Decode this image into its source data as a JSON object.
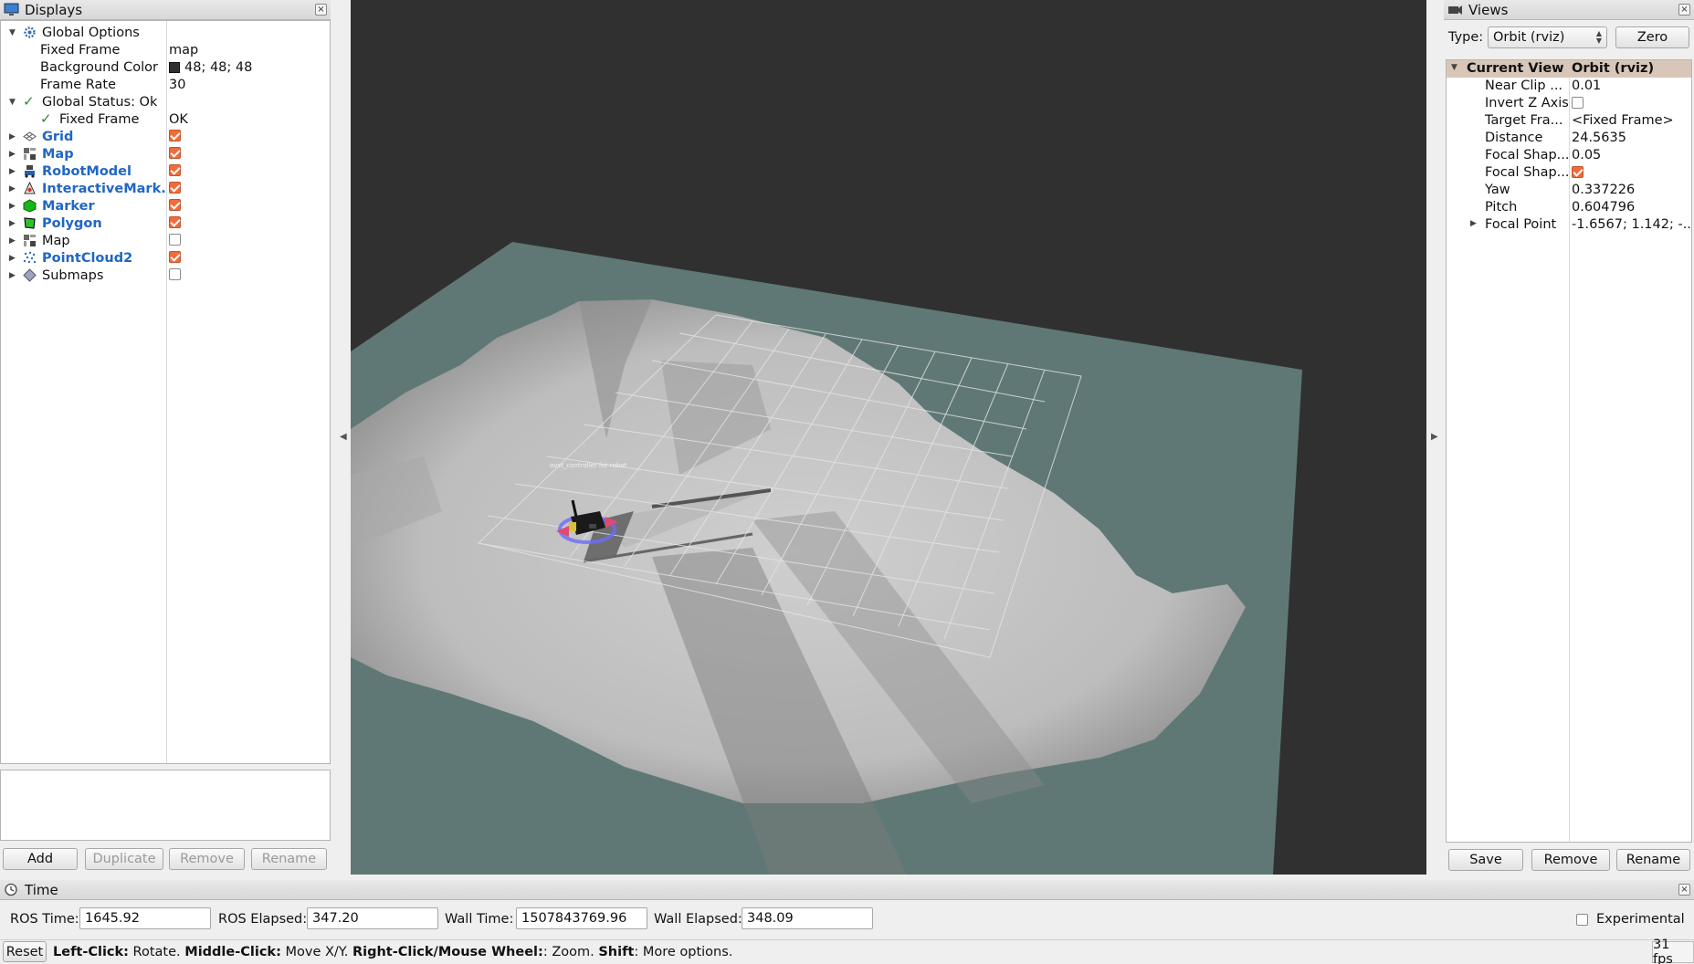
{
  "displays": {
    "title": "Displays",
    "global_options": {
      "label": "Global Options",
      "fixed_frame": {
        "label": "Fixed Frame",
        "value": "map"
      },
      "background_color": {
        "label": "Background Color",
        "value": "48; 48; 48",
        "swatch": "#303030"
      },
      "frame_rate": {
        "label": "Frame Rate",
        "value": "30"
      }
    },
    "global_status": {
      "label": "Global Status: Ok",
      "fixed_frame": {
        "label": "Fixed Frame",
        "value": "OK"
      }
    },
    "items": [
      {
        "label": "Grid",
        "enabled": true,
        "bold": true
      },
      {
        "label": "Map",
        "enabled": true,
        "bold": true
      },
      {
        "label": "RobotModel",
        "enabled": true,
        "bold": true
      },
      {
        "label": "InteractiveMark...",
        "enabled": true,
        "bold": true
      },
      {
        "label": "Marker",
        "enabled": true,
        "bold": true
      },
      {
        "label": "Polygon",
        "enabled": true,
        "bold": true
      },
      {
        "label": "Map",
        "enabled": false,
        "bold": false
      },
      {
        "label": "PointCloud2",
        "enabled": true,
        "bold": true
      },
      {
        "label": "Submaps",
        "enabled": false,
        "bold": false
      }
    ],
    "buttons": {
      "add": "Add",
      "duplicate": "Duplicate",
      "remove": "Remove",
      "rename": "Rename"
    }
  },
  "viewport": {
    "marker_text": "ovst_controller for robot"
  },
  "views": {
    "title": "Views",
    "type_label": "Type:",
    "type_value": "Orbit (rviz)",
    "zero_label": "Zero",
    "current_view": {
      "label": "Current View",
      "value": "Orbit (rviz)"
    },
    "props": [
      {
        "label": "Near Clip ...",
        "value": "0.01"
      },
      {
        "label": "Invert Z Axis",
        "checkbox": false
      },
      {
        "label": "Target Fra...",
        "value": "<Fixed Frame>"
      },
      {
        "label": "Distance",
        "value": "24.5635"
      },
      {
        "label": "Focal Shap...",
        "value": "0.05"
      },
      {
        "label": "Focal Shap...",
        "checkbox": true
      },
      {
        "label": "Yaw",
        "value": "0.337226"
      },
      {
        "label": "Pitch",
        "value": "0.604796"
      },
      {
        "label": "Focal Point",
        "value": "-1.6567; 1.142; -..."
      }
    ],
    "buttons": {
      "save": "Save",
      "remove": "Remove",
      "rename": "Rename"
    }
  },
  "time": {
    "title": "Time",
    "ros_time": {
      "label": "ROS Time:",
      "value": "1645.92"
    },
    "ros_elapsed": {
      "label": "ROS Elapsed:",
      "value": "347.20"
    },
    "wall_time": {
      "label": "Wall Time:",
      "value": "1507843769.96"
    },
    "wall_elapsed": {
      "label": "Wall Elapsed:",
      "value": "348.09"
    },
    "experimental": "Experimental"
  },
  "status": {
    "reset": "Reset",
    "hint": [
      {
        "b": "Left-Click:",
        "t": " Rotate. "
      },
      {
        "b": "Middle-Click:",
        "t": " Move X/Y. "
      },
      {
        "b": "Right-Click/Mouse Wheel:",
        "t": ": Zoom. "
      },
      {
        "b": "Shift",
        "t": ": More options."
      }
    ],
    "fps": "31 fps"
  },
  "colors": {
    "checkbox_on": "#f26b3a",
    "bold_item": "#2166c4",
    "viewport_bg": "#303030",
    "ground": "#5f7876",
    "header_row": "#d8c7b8"
  }
}
